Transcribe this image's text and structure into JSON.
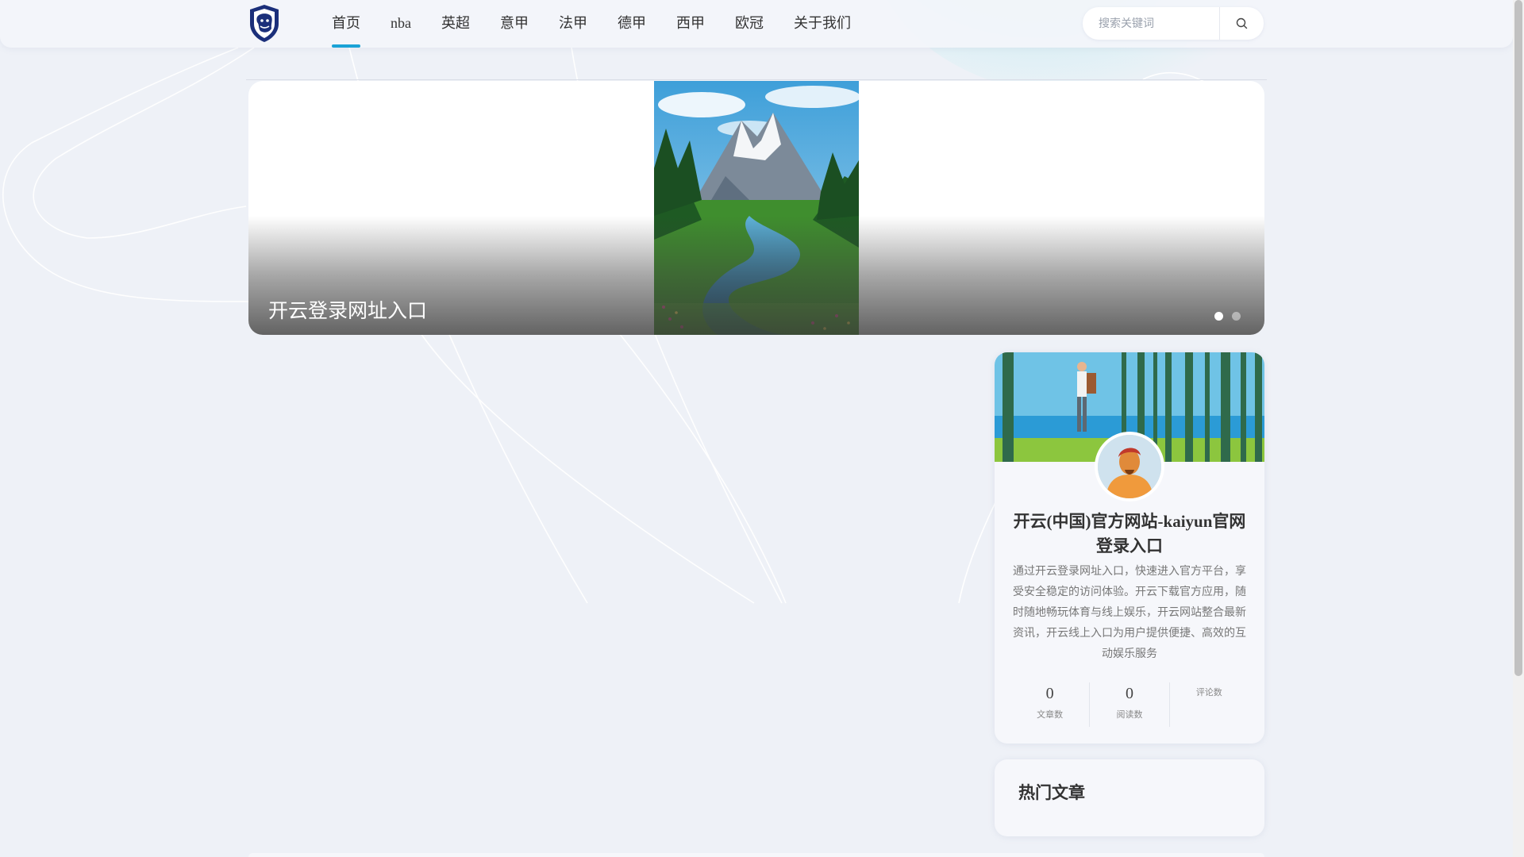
{
  "nav": {
    "items": [
      {
        "label": "首页",
        "active": true
      },
      {
        "label": "nba"
      },
      {
        "label": "英超"
      },
      {
        "label": "意甲"
      },
      {
        "label": "法甲"
      },
      {
        "label": "德甲"
      },
      {
        "label": "西甲"
      },
      {
        "label": "欧冠"
      },
      {
        "label": "关于我们"
      }
    ]
  },
  "search": {
    "placeholder": "搜索关键词",
    "icon": "search-icon"
  },
  "banner": {
    "title": "开云登录网址入口",
    "slides": 2,
    "current_slide": 1
  },
  "profile": {
    "name": "开云(中国)官方网站-kaiyun官网登录入口",
    "description": "通过开云登录网址入口，快速进入官方平台，享受安全稳定的访问体验。开云下载官方应用，随时随地畅玩体育与线上娱乐，开云网站整合最新资讯，开云线上入口为用户提供便捷、高效的互动娱乐服务",
    "stats": [
      {
        "value": "0",
        "label": "文章数"
      },
      {
        "value": "0",
        "label": "阅读数"
      },
      {
        "value": "",
        "label": "评论数"
      }
    ]
  },
  "hot": {
    "title": "热门文章"
  },
  "colors": {
    "accent": "#1aa2d6",
    "background": "#eef1f7"
  }
}
